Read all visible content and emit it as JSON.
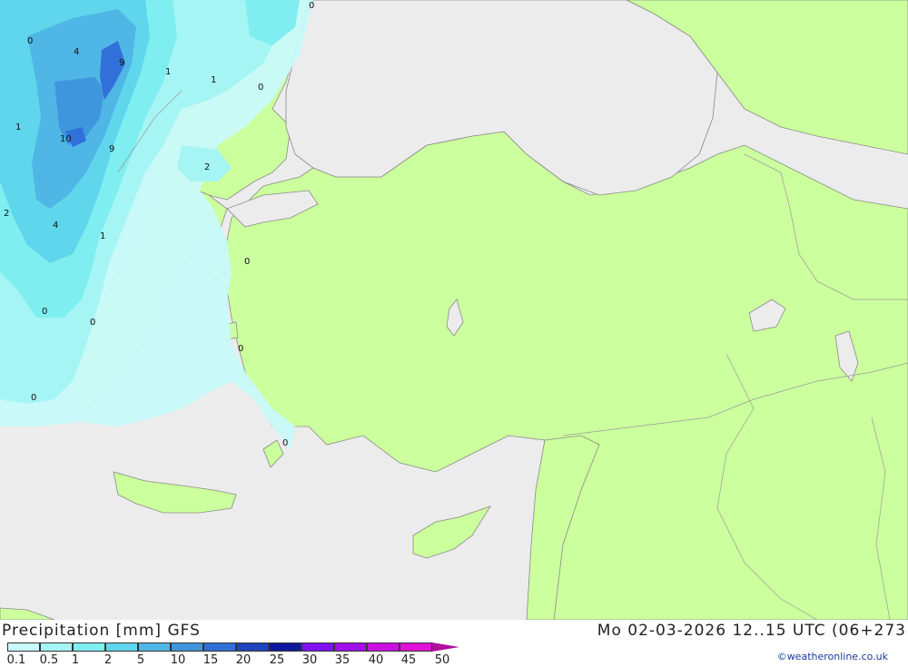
{
  "header": {
    "left_title": "Precipitation [mm] GFS",
    "right_title": "Mo 02-03-2026 12..15 UTC (06+273"
  },
  "legend": {
    "ticks": [
      "0.1",
      "0.5",
      "1",
      "2",
      "5",
      "10",
      "15",
      "20",
      "25",
      "30",
      "35",
      "40",
      "45",
      "50"
    ],
    "colors": [
      "#c8fafa",
      "#a6f5f5",
      "#7eeef0",
      "#5fd6ec",
      "#4fb6e6",
      "#3f96dc",
      "#3070d8",
      "#1f44c0",
      "#1018a0",
      "#8010f0",
      "#a010e8",
      "#c810e0",
      "#e010d8",
      "#b0109c"
    ]
  },
  "credit": "©weatheronline.co.uk",
  "map": {
    "colors": {
      "sea": "#ececec",
      "land": "#ccff9d",
      "border": "#888888"
    },
    "contour_labels": [
      {
        "text": "0"
      },
      {
        "text": "4"
      },
      {
        "text": "9"
      },
      {
        "text": "1"
      },
      {
        "text": "1"
      },
      {
        "text": "0"
      },
      {
        "text": "1"
      },
      {
        "text": "10"
      },
      {
        "text": "9"
      },
      {
        "text": "2"
      },
      {
        "text": "2"
      },
      {
        "text": "4"
      },
      {
        "text": "1"
      },
      {
        "text": "0"
      },
      {
        "text": "0"
      },
      {
        "text": "0"
      },
      {
        "text": "0"
      },
      {
        "text": "0"
      },
      {
        "text": "0"
      },
      {
        "text": "0"
      }
    ]
  }
}
